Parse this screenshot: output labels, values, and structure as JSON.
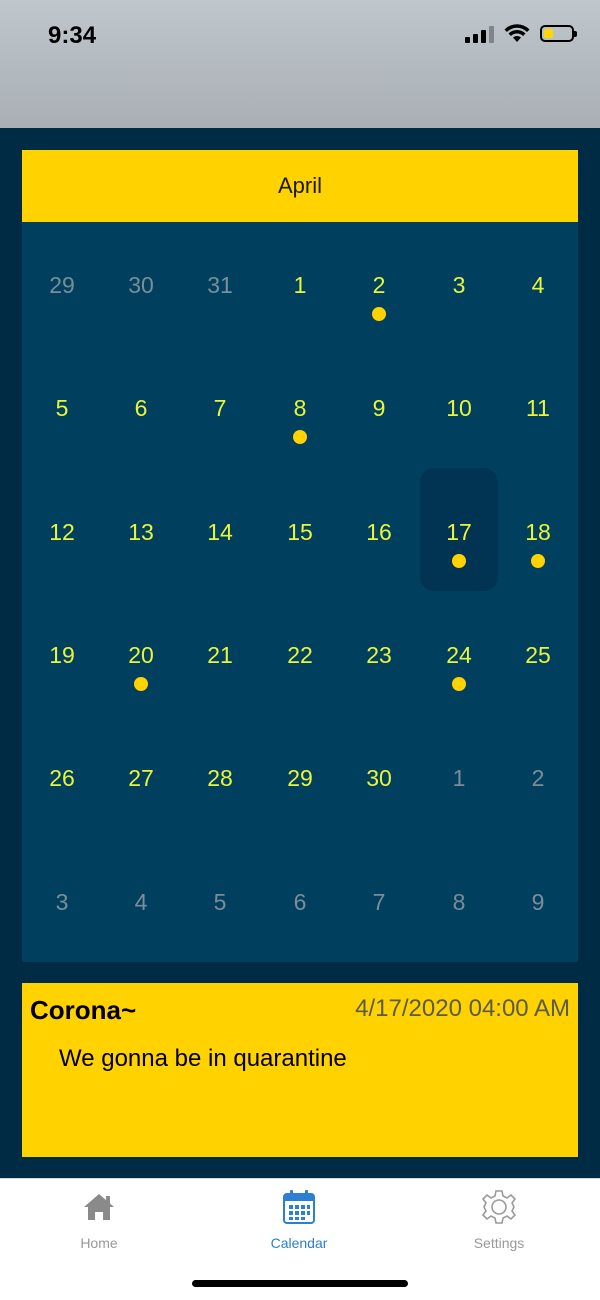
{
  "status_bar": {
    "time": "9:34",
    "battery_icon": "battery-low-icon",
    "wifi_icon": "wifi-icon",
    "signal_icon": "cellular-signal-icon",
    "battery_level_fraction": 0.25
  },
  "calendar": {
    "month": "April",
    "weeks": [
      [
        {
          "d": "29",
          "o": true
        },
        {
          "d": "30",
          "o": true
        },
        {
          "d": "31",
          "o": true
        },
        {
          "d": "1"
        },
        {
          "d": "2",
          "e": true
        },
        {
          "d": "3"
        },
        {
          "d": "4"
        }
      ],
      [
        {
          "d": "5"
        },
        {
          "d": "6"
        },
        {
          "d": "7"
        },
        {
          "d": "8",
          "e": true
        },
        {
          "d": "9"
        },
        {
          "d": "10"
        },
        {
          "d": "11"
        }
      ],
      [
        {
          "d": "12"
        },
        {
          "d": "13"
        },
        {
          "d": "14"
        },
        {
          "d": "15"
        },
        {
          "d": "16"
        },
        {
          "d": "17",
          "e": true,
          "s": true
        },
        {
          "d": "18",
          "e": true
        }
      ],
      [
        {
          "d": "19"
        },
        {
          "d": "20",
          "e": true
        },
        {
          "d": "21"
        },
        {
          "d": "22"
        },
        {
          "d": "23"
        },
        {
          "d": "24",
          "e": true
        },
        {
          "d": "25"
        }
      ],
      [
        {
          "d": "26"
        },
        {
          "d": "27"
        },
        {
          "d": "28"
        },
        {
          "d": "29"
        },
        {
          "d": "30"
        },
        {
          "d": "1",
          "o": true
        },
        {
          "d": "2",
          "o": true
        }
      ],
      [
        {
          "d": "3",
          "o": true
        },
        {
          "d": "4",
          "o": true
        },
        {
          "d": "5",
          "o": true
        },
        {
          "d": "6",
          "o": true
        },
        {
          "d": "7",
          "o": true
        },
        {
          "d": "8",
          "o": true
        },
        {
          "d": "9",
          "o": true
        }
      ]
    ],
    "colors": {
      "header_bg": "#ffd200",
      "grid_bg": "#003f5e",
      "day_text": "#e8f53a",
      "other_month_text": "#7a8d99",
      "event_dot": "#ffd200"
    }
  },
  "event": {
    "title": "Corona~",
    "datetime": "4/17/2020 04:00 AM",
    "description": "We gonna be in quarantine"
  },
  "tabbar": {
    "tabs": [
      {
        "label": "Home",
        "icon": "home-icon",
        "active": false
      },
      {
        "label": "Calendar",
        "icon": "calendar-icon",
        "active": true
      },
      {
        "label": "Settings",
        "icon": "gear-icon",
        "active": false
      }
    ],
    "active_color": "#2c7fd1"
  }
}
